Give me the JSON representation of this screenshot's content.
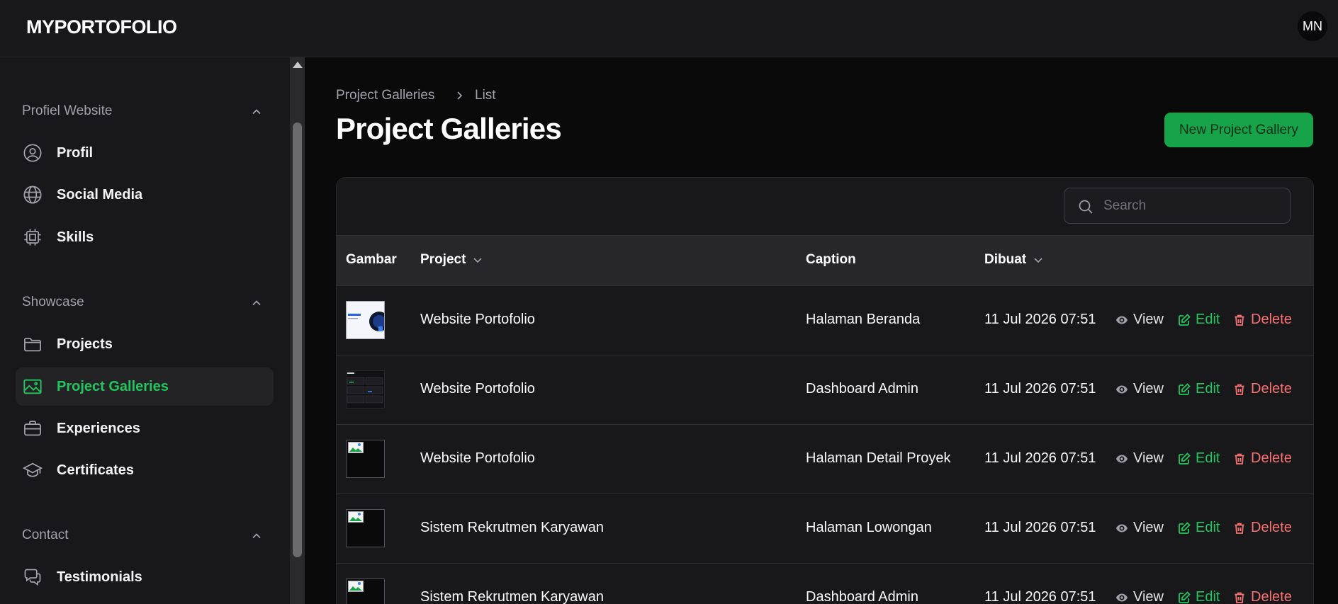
{
  "app": {
    "brand": "MYPORTOFOLIO",
    "user_initials": "MN"
  },
  "sidebar": {
    "groups": [
      {
        "label": "Profiel Website",
        "items": [
          {
            "label": "Profil",
            "icon": "user-circle-icon"
          },
          {
            "label": "Social Media",
            "icon": "globe-icon"
          },
          {
            "label": "Skills",
            "icon": "cpu-chip-icon"
          }
        ]
      },
      {
        "label": "Showcase",
        "items": [
          {
            "label": "Projects",
            "icon": "folder-icon"
          },
          {
            "label": "Project Galleries",
            "icon": "photo-icon",
            "active": true
          },
          {
            "label": "Experiences",
            "icon": "briefcase-icon"
          },
          {
            "label": "Certificates",
            "icon": "academic-cap-icon"
          }
        ]
      },
      {
        "label": "Contact",
        "items": [
          {
            "label": "Testimonials",
            "icon": "chat-bubbles-icon"
          }
        ]
      }
    ]
  },
  "page": {
    "breadcrumb": [
      "Project Galleries",
      "List"
    ],
    "title": "Project Galleries",
    "new_button": "New Project Gallery",
    "search_placeholder": "Search"
  },
  "table": {
    "columns": [
      "Gambar",
      "Project",
      "Caption",
      "Dibuat"
    ],
    "actions": {
      "view": "View",
      "edit": "Edit",
      "delete": "Delete"
    },
    "rows": [
      {
        "project": "Website Portofolio",
        "caption": "Halaman Beranda",
        "created": "11 Jul 2026 07:51",
        "image": "light-screenshot"
      },
      {
        "project": "Website Portofolio",
        "caption": "Dashboard Admin",
        "created": "11 Jul 2026 07:51",
        "image": "dark-screenshot"
      },
      {
        "project": "Website Portofolio",
        "caption": "Halaman Detail Proyek",
        "created": "11 Jul 2026 07:51",
        "image": "broken"
      },
      {
        "project": "Sistem Rekrutmen Karyawan",
        "caption": "Halaman Lowongan",
        "created": "11 Jul 2026 07:51",
        "image": "broken"
      },
      {
        "project": "Sistem Rekrutmen Karyawan",
        "caption": "Dashboard Admin",
        "created": "11 Jul 2026 07:51",
        "image": "broken"
      }
    ]
  },
  "colors": {
    "accent": "#22c55e",
    "danger": "#f87171",
    "background": "#0a0a0b",
    "panel": "#18181b"
  }
}
